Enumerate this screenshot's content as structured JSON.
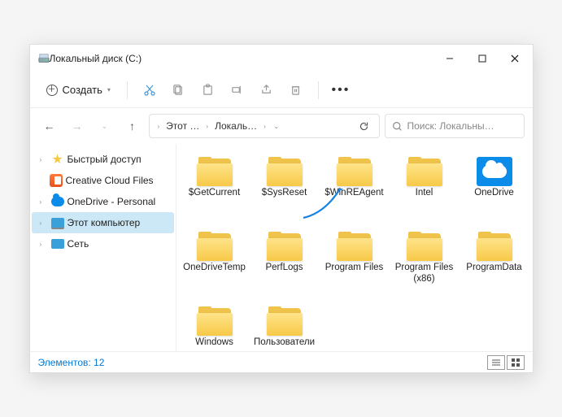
{
  "titlebar": {
    "title": "Локальный диск (C:)"
  },
  "toolbar": {
    "new_label": "Создать"
  },
  "breadcrumbs": {
    "b0": "Этот …",
    "b1": "Локаль…"
  },
  "search": {
    "placeholder": "Поиск: Локальны…"
  },
  "sidebar": {
    "quick": "Быстрый доступ",
    "creative": "Creative Cloud Files",
    "onedrive": "OneDrive - Personal",
    "thispc": "Этот компьютер",
    "network": "Сеть"
  },
  "folders": {
    "f0": "$GetCurrent",
    "f1": "$SysReset",
    "f2": "$WinREAgent",
    "f3": "Intel",
    "f4": "OneDrive",
    "f5": "OneDriveTemp",
    "f6": "PerfLogs",
    "f7": "Program Files",
    "f8": "Program Files (x86)",
    "f9": "ProgramData",
    "f10": "Windows",
    "f11": "Пользователи"
  },
  "status": {
    "text": "Элементов: 12"
  }
}
